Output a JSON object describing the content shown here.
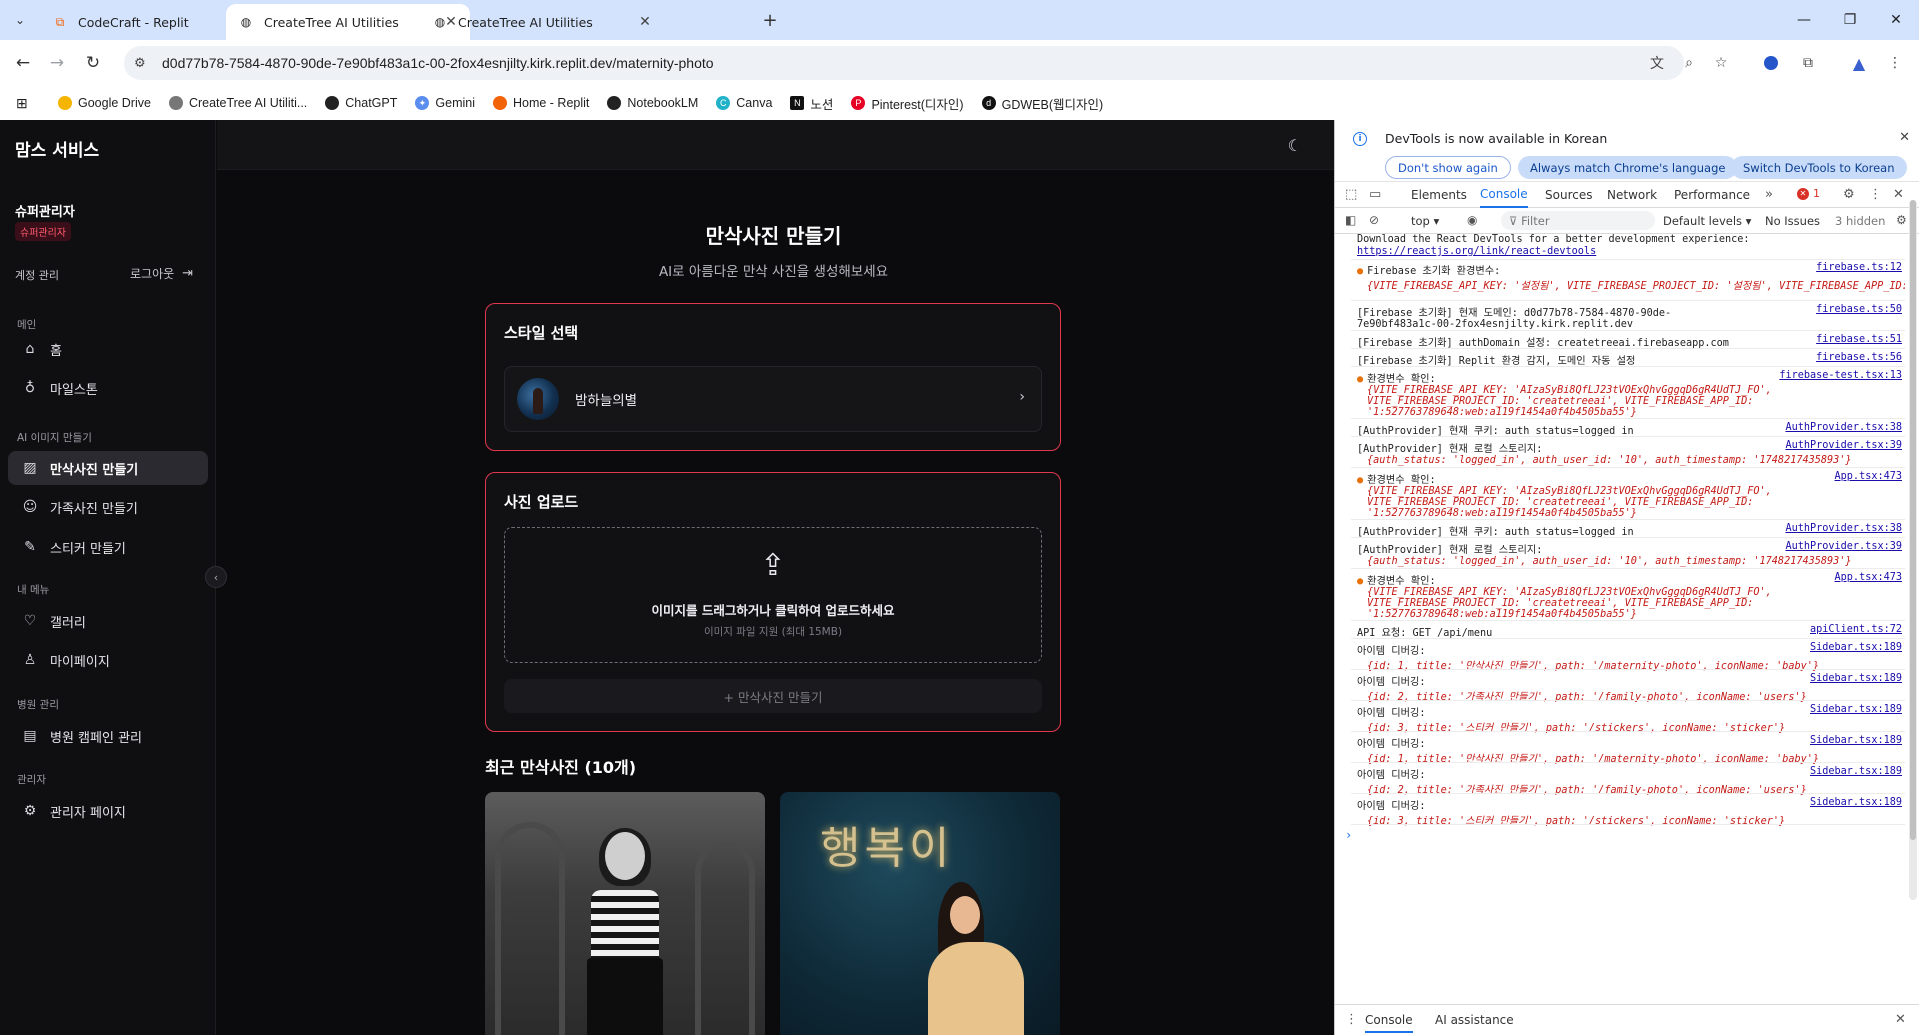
{
  "browser": {
    "tabs": [
      {
        "title": "CodeCraft - Replit",
        "active": false
      },
      {
        "title": "CreateTree AI Utilities",
        "active": true
      },
      {
        "title": "CreateTree AI Utilities",
        "active": false
      }
    ],
    "url": "d0d77b78-7584-4870-90de-7e90bf483a1c-00-2fox4esnjilty.kirk.replit.dev/maternity-photo",
    "bookmarks": [
      "Google Drive",
      "CreateTree AI Utiliti...",
      "ChatGPT",
      "Gemini",
      "Home - Replit",
      "NotebookLM",
      "Canva",
      "노션",
      "Pinterest(디자인)",
      "GDWEB(웹디자인)"
    ]
  },
  "sidebar": {
    "brand": "맘스 서비스",
    "user_name": "슈퍼관리자",
    "user_role": "슈퍼관리자",
    "account": "계정 관리",
    "logout": "로그아웃",
    "sections": {
      "main": "메인",
      "ai": "AI 이미지 만들기",
      "my": "내 메뉴",
      "hospital": "병원 관리",
      "admin": "관리자"
    },
    "items": {
      "home": "홈",
      "milestone": "마일스톤",
      "maternity": "만삭사진 만들기",
      "family": "가족사진 만들기",
      "sticker": "스티커 만들기",
      "gallery": "갤러리",
      "mypage": "마이페이지",
      "campaign": "병원 캠페인 관리",
      "admin_page": "관리자 페이지"
    }
  },
  "main": {
    "title": "만삭사진 만들기",
    "subtitle": "AI로 아름다운 만삭 사진을 생성해보세요",
    "style_card": {
      "title": "스타일 선택",
      "selected": "밤하늘의별"
    },
    "upload_card": {
      "title": "사진 업로드",
      "drop_text": "이미지를 드래그하거나 클릭하여 업로드하세요",
      "drop_hint": "이미지 파일 지원 (최대 15MB)",
      "button": "+ 만삭사진 만들기"
    },
    "recent_title": "최근 만삭사진 (10개)",
    "photo2_overlay": "행복이"
  },
  "devtools": {
    "banner": "DevTools is now available in Korean",
    "btn_dont_show": "Don't show again",
    "btn_match": "Always match Chrome's language",
    "btn_switch": "Switch DevTools to Korean",
    "tabs": [
      "Elements",
      "Console",
      "Sources",
      "Network",
      "Performance"
    ],
    "error_count": "1",
    "context": "top",
    "filter_placeholder": "Filter",
    "levels": "Default levels",
    "issues": "No Issues",
    "hidden": "3 hidden",
    "drawer_tabs": [
      "Console",
      "AI assistance"
    ],
    "logs": [
      {
        "text": "Download the React DevTools for a better development experience:",
        "src": ""
      },
      {
        "text": "https://reactjs.org/link/react-devtools",
        "src": ""
      },
      {
        "text": "Firebase 초기화 환경변수:",
        "src": "firebase.ts:12",
        "obj": "{VITE_FIREBASE_API_KEY: '설정됨', VITE_FIREBASE_PROJECT_ID: '설정됨', VITE_FIREBASE_APP_ID: '설정됨'}"
      },
      {
        "text": "[Firebase 초기화] 현재 도메인: d0d77b78-7584-4870-90de-7e90bf483a1c-00-2fox4esnjilty.kirk.replit.dev",
        "src": "firebase.ts:50"
      },
      {
        "text": "[Firebase 초기화] authDomain 설정: createtreeai.firebaseapp.com",
        "src": "firebase.ts:51"
      },
      {
        "text": "[Firebase 초기화] Replit 환경 감지, 도메인 자동 설정",
        "src": "firebase.ts:56"
      },
      {
        "text": "환경변수 확인:",
        "src": "firebase-test.tsx:13",
        "obj": "{VITE_FIREBASE_API_KEY: 'AIzaSyBi8QfLJ23tVOExQhvGggqD6gR4UdTJ_FO', VITE_FIREBASE_PROJECT_ID: 'createtreeai', VITE_FIREBASE_APP_ID: '1:527763789648:web:a119f1454a0f4b4505ba55'}"
      },
      {
        "text": "[AuthProvider] 현재 쿠키: auth_status=logged_in",
        "src": "AuthProvider.tsx:38"
      },
      {
        "text": "[AuthProvider] 현재 로컬 스토리지:",
        "src": "AuthProvider.tsx:39",
        "obj": "{auth_status: 'logged_in', auth_user_id: '10', auth_timestamp: '1748217435893'}"
      },
      {
        "text": "환경변수 확인:",
        "src": "App.tsx:473",
        "obj": "{VITE_FIREBASE_API_KEY: 'AIzaSyBi8QfLJ23tVOExQhvGggqD6gR4UdTJ_FO', VITE_FIREBASE_PROJECT_ID: 'createtreeai', VITE_FIREBASE_APP_ID: '1:527763789648:web:a119f1454a0f4b4505ba55'}"
      },
      {
        "text": "[AuthProvider] 현재 쿠키: auth_status=logged_in",
        "src": "AuthProvider.tsx:38"
      },
      {
        "text": "[AuthProvider] 현재 로컬 스토리지:",
        "src": "AuthProvider.tsx:39",
        "obj": "{auth_status: 'logged_in', auth_user_id: '10', auth_timestamp: '1748217435893'}"
      },
      {
        "text": "환경변수 확인:",
        "src": "App.tsx:473",
        "obj": "{VITE_FIREBASE_API_KEY: 'AIzaSyBi8QfLJ23tVOExQhvGggqD6gR4UdTJ_FO', VITE_FIREBASE_PROJECT_ID: 'createtreeai', VITE_FIREBASE_APP_ID: '1:527763789648:web:a119f1454a0f4b4505ba55'}"
      },
      {
        "text": "API 요청: GET /api/menu",
        "src": "apiClient.ts:72"
      },
      {
        "text": "아이템 디버깅:",
        "src": "Sidebar.tsx:189",
        "obj": "{id: 1, title: '만삭사진 만들기', path: '/maternity-photo', iconName: 'baby'}"
      },
      {
        "text": "아이템 디버깅:",
        "src": "Sidebar.tsx:189",
        "obj": "{id: 2, title: '가족사진 만들기', path: '/family-photo', iconName: 'users'}"
      },
      {
        "text": "아이템 디버깅:",
        "src": "Sidebar.tsx:189",
        "obj": "{id: 3, title: '스티커 만들기', path: '/stickers', iconName: 'sticker'}"
      },
      {
        "text": "아이템 디버깅:",
        "src": "Sidebar.tsx:189",
        "obj": "{id: 1, title: '만삭사진 만들기', path: '/maternity-photo', iconName: 'baby'}"
      },
      {
        "text": "아이템 디버깅:",
        "src": "Sidebar.tsx:189",
        "obj": "{id: 2, title: '가족사진 만들기', path: '/family-photo', iconName: 'users'}"
      },
      {
        "text": "아이템 디버깅:",
        "src": "Sidebar.tsx:189",
        "obj": "{id: 3, title: '스티커 만들기', path: '/stickers', iconName: 'sticker'}"
      }
    ]
  }
}
